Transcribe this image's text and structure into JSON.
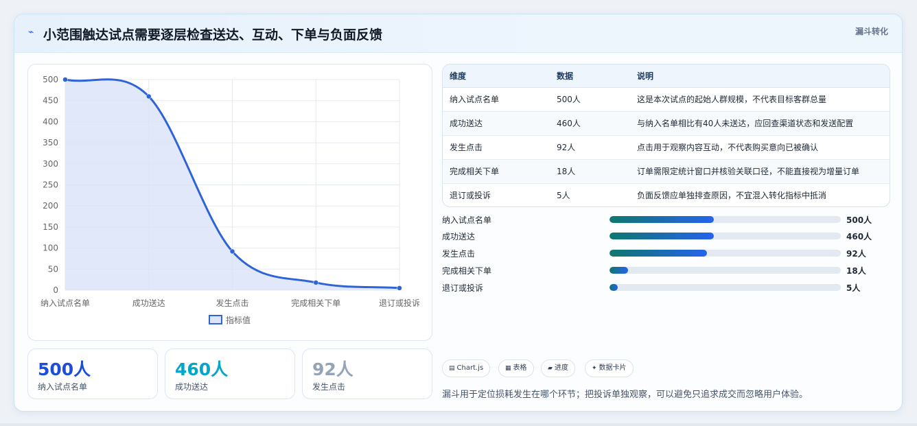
{
  "header": {
    "title": "小范围触达试点需要逐层检查送达、互动、下单与负面反馈",
    "tag": "漏斗转化",
    "icon": "trend-line-icon"
  },
  "chart_data": {
    "type": "line",
    "categories": [
      "纳入试点名单",
      "成功送达",
      "发生点击",
      "完成相关下单",
      "退订或投诉"
    ],
    "series": [
      {
        "name": "指标值",
        "values": [
          500,
          460,
          92,
          18,
          5
        ]
      }
    ],
    "ylim": [
      0,
      500
    ],
    "yticks": [
      "0",
      "50",
      "100",
      "150",
      "200",
      "250",
      "300",
      "350",
      "400",
      "450",
      "500"
    ],
    "legend": "bottom",
    "grid": true,
    "area_fill": true,
    "colors": {
      "line": "#2f63d8",
      "fill": "#dbe4f8"
    }
  },
  "stats": [
    {
      "value": "500人",
      "label": "纳入试点名单",
      "color": "#1d4ed8"
    },
    {
      "value": "460人",
      "label": "成功送达",
      "color": "#06a6c8"
    },
    {
      "value": "92人",
      "label": "发生点击",
      "color": "#94a3b8"
    }
  ],
  "table": {
    "headers": [
      "维度",
      "数据",
      "说明"
    ],
    "rows": [
      [
        "纳入试点名单",
        "500人",
        "这是本次试点的起始人群规模，不代表目标客群总量"
      ],
      [
        "成功送达",
        "460人",
        "与纳入名单相比有40人未送达，应回查渠道状态和发送配置"
      ],
      [
        "发生点击",
        "92人",
        "点击用于观察内容互动，不代表购买意向已被确认"
      ],
      [
        "完成相关下单",
        "18人",
        "订单需限定统计窗口并核验关联口径，不能直接视为增量订单"
      ],
      [
        "退订或投诉",
        "5人",
        "负面反馈应单独排查原因，不宜混入转化指标中抵消"
      ]
    ]
  },
  "progress": [
    {
      "label": "纳入试点名单",
      "value": "500人",
      "fraction": 0.45
    },
    {
      "label": "成功送达",
      "value": "460人",
      "fraction": 0.45
    },
    {
      "label": "发生点击",
      "value": "92人",
      "fraction": 0.42
    },
    {
      "label": "完成相关下单",
      "value": "18人",
      "fraction": 0.08
    },
    {
      "label": "退订或投诉",
      "value": "5人",
      "fraction": 0.035
    }
  ],
  "chips": [
    {
      "icon": "chart-icon",
      "glyph": "▤",
      "label": "Chart.js"
    },
    {
      "icon": "table-icon",
      "glyph": "▦",
      "label": "表格"
    },
    {
      "icon": "progress-icon",
      "glyph": "▰",
      "label": "进度"
    },
    {
      "icon": "card-icon",
      "glyph": "✦",
      "label": "数据卡片"
    }
  ],
  "note": "漏斗用于定位损耗发生在哪个环节；把投诉单独观察，可以避免只追求成交而忽略用户体验。"
}
